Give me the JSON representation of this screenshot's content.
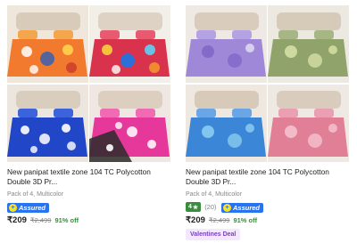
{
  "products": [
    {
      "title": "New panipat textile zone 104 TC Polycotton Double 3D Pr...",
      "subtitle": "Pack of 4, Multicolor",
      "assured_label": "Assured",
      "price": "₹209",
      "mrp": "₹2,499",
      "discount": "91% off",
      "image_icon": "bedsheet-collage-image",
      "colors": [
        "#f27a2e",
        "#d8324d",
        "#2146c7",
        "#e6379a"
      ]
    },
    {
      "title": "New panipat textile zone 104 TC Polycotton Double 3D Pr...",
      "subtitle": "Pack of 4, Multicolor",
      "rating": "4",
      "rating_star": "★",
      "review_count": "(20)",
      "assured_label": "Assured",
      "price": "₹209",
      "mrp": "₹2,499",
      "discount": "91% off",
      "deal_label": "Valentines Deal",
      "image_icon": "bedsheet-collage-image",
      "colors": [
        "#9f88d8",
        "#8fa36a",
        "#3b86d6",
        "#e17f96"
      ]
    }
  ]
}
